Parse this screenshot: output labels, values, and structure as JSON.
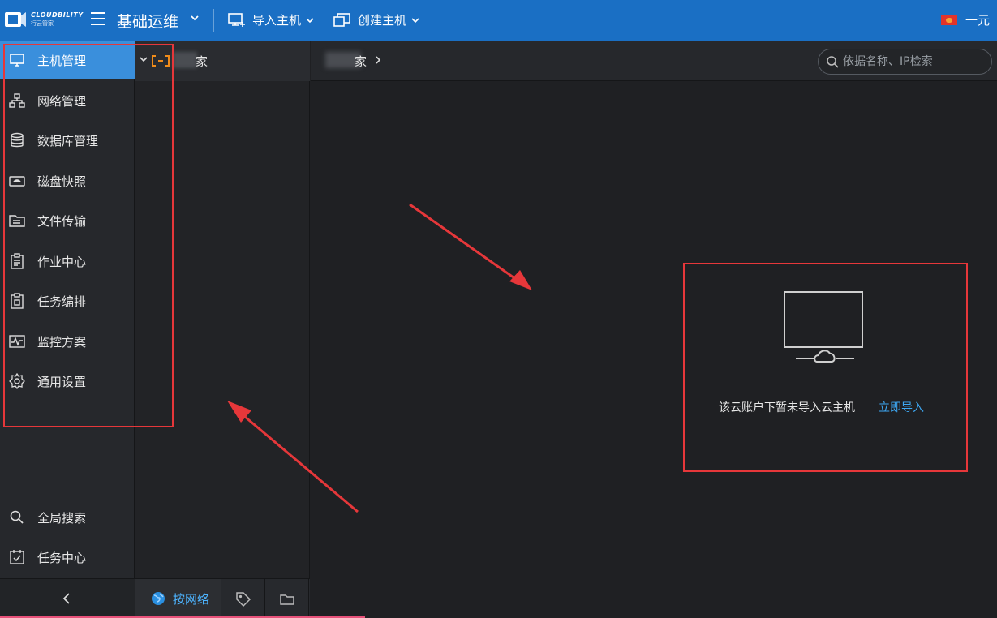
{
  "header": {
    "logo_line1": "CLOUDBILITY",
    "logo_line2": "行云管家",
    "title": "基础运维",
    "menu": [
      {
        "label": "导入主机"
      },
      {
        "label": "创建主机"
      }
    ],
    "user": "一元"
  },
  "sidebar": {
    "items": [
      {
        "label": "主机管理",
        "icon": "monitor-icon",
        "active": true
      },
      {
        "label": "网络管理",
        "icon": "network-icon"
      },
      {
        "label": "数据库管理",
        "icon": "database-icon"
      },
      {
        "label": "磁盘快照",
        "icon": "disk-snapshot-icon"
      },
      {
        "label": "文件传输",
        "icon": "file-transfer-icon"
      },
      {
        "label": "作业中心",
        "icon": "clipboard-icon"
      },
      {
        "label": "任务编排",
        "icon": "task-orchestration-icon"
      },
      {
        "label": "监控方案",
        "icon": "monitoring-icon"
      },
      {
        "label": "通用设置",
        "icon": "gear-icon"
      }
    ],
    "bottom_items": [
      {
        "label": "全局搜索",
        "icon": "search-icon"
      },
      {
        "label": "任务中心",
        "icon": "task-center-icon"
      }
    ]
  },
  "tree": {
    "node_label": "家",
    "footer_tabs": [
      {
        "label": "按网络",
        "icon": "globe-icon",
        "active": true
      },
      {
        "label": "",
        "icon": "tag-icon"
      },
      {
        "label": "",
        "icon": "folder-icon"
      }
    ]
  },
  "main": {
    "breadcrumb": "家",
    "search_placeholder": "依据名称、IP检索",
    "empty_message": "该云账户下暂未导入云主机",
    "empty_action": "立即导入"
  },
  "colors": {
    "topbar": "#1a6fc4",
    "active_nav": "#3a8fdc",
    "link": "#3ea9f5",
    "annotation": "#e6373a"
  }
}
